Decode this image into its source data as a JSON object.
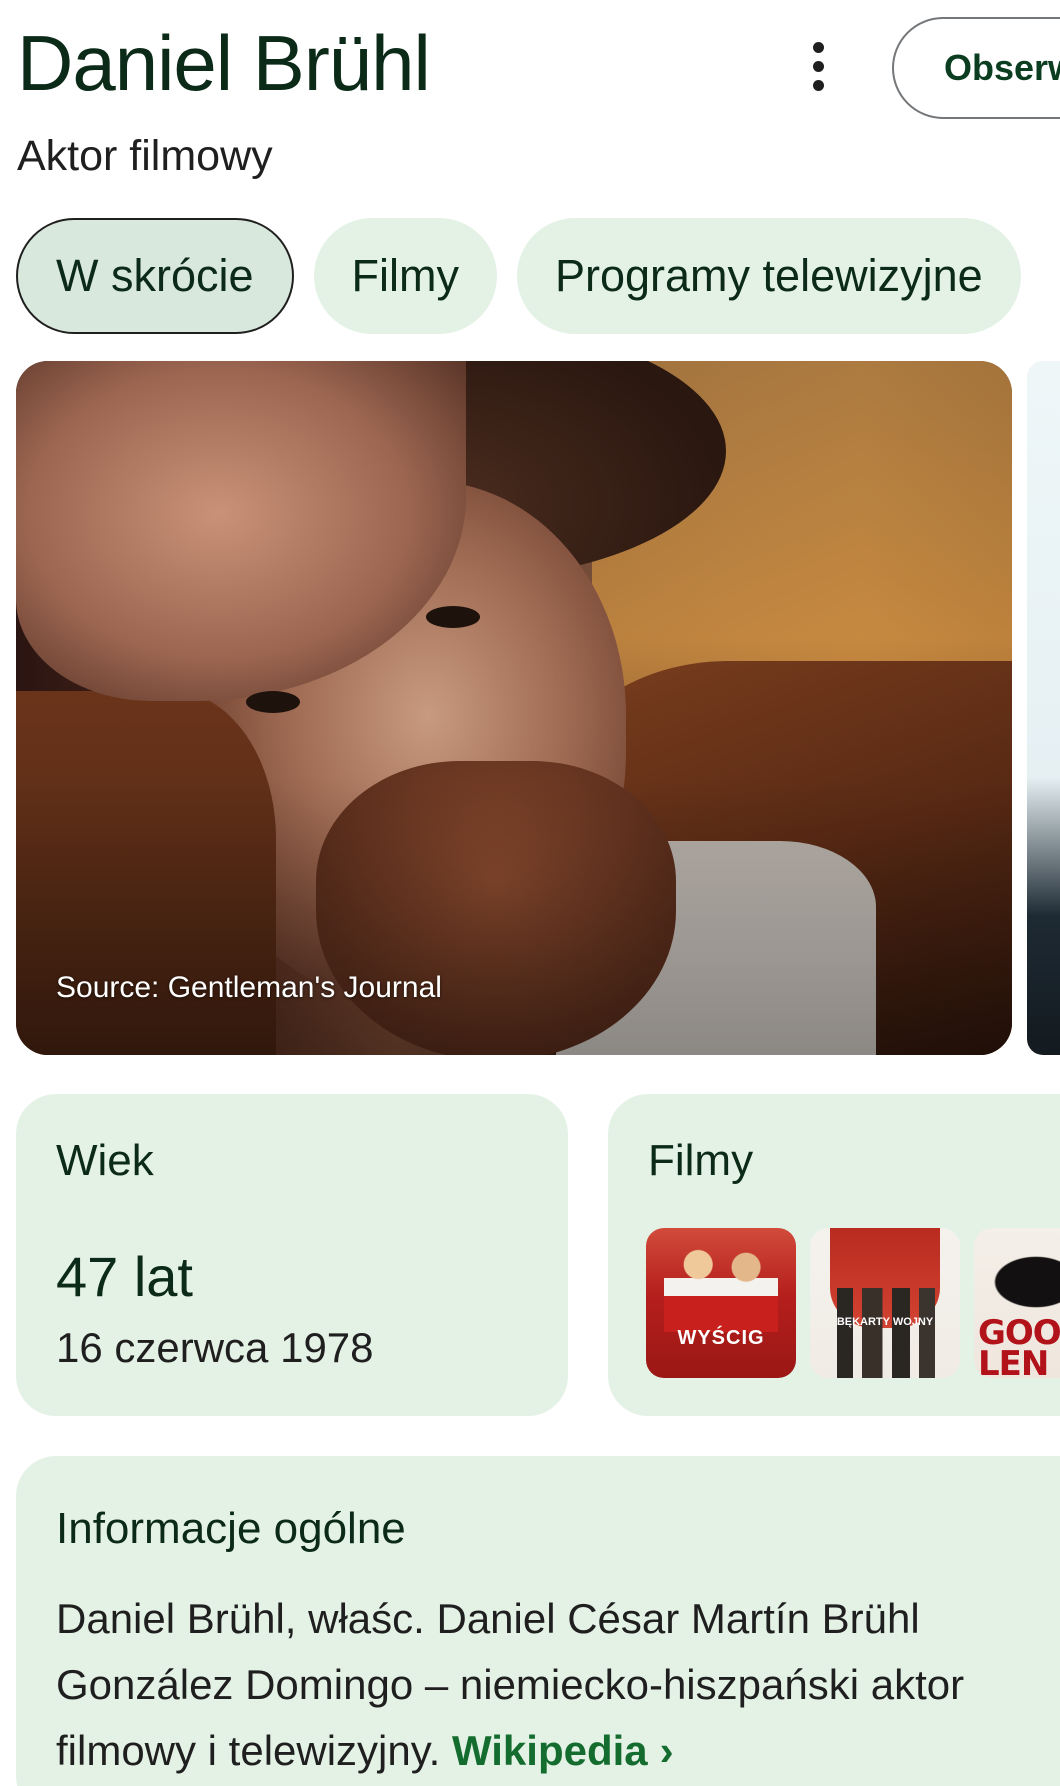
{
  "header": {
    "title": "Daniel Brühl",
    "subtitle": "Aktor filmowy",
    "follow_label": "Obserwuj"
  },
  "tabs": [
    {
      "label": "W skrócie",
      "active": true
    },
    {
      "label": "Filmy",
      "active": false
    },
    {
      "label": "Programy telewizyjne",
      "active": false
    }
  ],
  "hero": {
    "source": "Source: Gentleman's Journal"
  },
  "age_card": {
    "label": "Wiek",
    "value": "47 lat",
    "date": "16 czerwca 1978"
  },
  "films_card": {
    "label": "Filmy",
    "posters": [
      {
        "title_text": "WYŚCIG"
      },
      {
        "title_text": "BĘKARTY WOJNY"
      },
      {
        "title_text": "GOOD LEN"
      }
    ]
  },
  "overview": {
    "label": "Informacje ogólne",
    "text": "Daniel Brühl, właśc. Daniel César Martín Brühl González Domingo – niemiecko-hiszpański aktor filmowy i telewizyjny.",
    "link_label": "Wikipedia",
    "link_chevron": "›"
  },
  "colors": {
    "card_bg": "#e4f2e6",
    "accent_link": "#146c2e",
    "title_text": "#0b2a17"
  },
  "icons": {
    "menu": "more-vert-icon",
    "chevron": "chevron-right-icon"
  }
}
